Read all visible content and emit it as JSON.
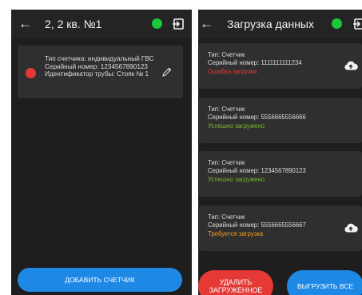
{
  "colors": {
    "online": "#19c93a",
    "error": "#e53935",
    "success": "#7ab631",
    "warning": "#f29b21",
    "accent": "#1e88e5"
  },
  "left": {
    "title": "2, 2 кв. №1",
    "back_icon": "back-arrow-icon",
    "exit_icon": "exit-icon",
    "meter": {
      "type": "Тип счетчика: индивидуальный ГВС",
      "serial": "Серийный номер: 1234567890123",
      "pipe": "Идентификатор трубы: Стояк № 1"
    },
    "add_button": "ДОБАВИТЬ СЧЕТЧИК"
  },
  "right": {
    "title": "Загрузка данных",
    "items": [
      {
        "type": "Тип: Счетчик",
        "serial": "Серийный номер: 1111111111234",
        "status": "Ошибка загрузки",
        "icon": "cloud-upload-icon"
      },
      {
        "type": "Тип: Счетчик",
        "serial": "Серийный номер: 5556665556666",
        "status": "Успешно загружено"
      },
      {
        "type": "Тип: Счетчик",
        "serial": "Серийный номер: 1234567890123",
        "status": "Успешно загружено"
      },
      {
        "type": "Тип: Счетчик",
        "serial": "Серийный номер: 5556665556667",
        "status": "Требуется загрузка",
        "icon": "cloud-upload-icon"
      }
    ],
    "delete_button": "УДАЛИТЬ ЗАГРУЖЕННОЕ",
    "upload_all_button": "ВЫГРУЗИТЬ ВСЕ"
  }
}
